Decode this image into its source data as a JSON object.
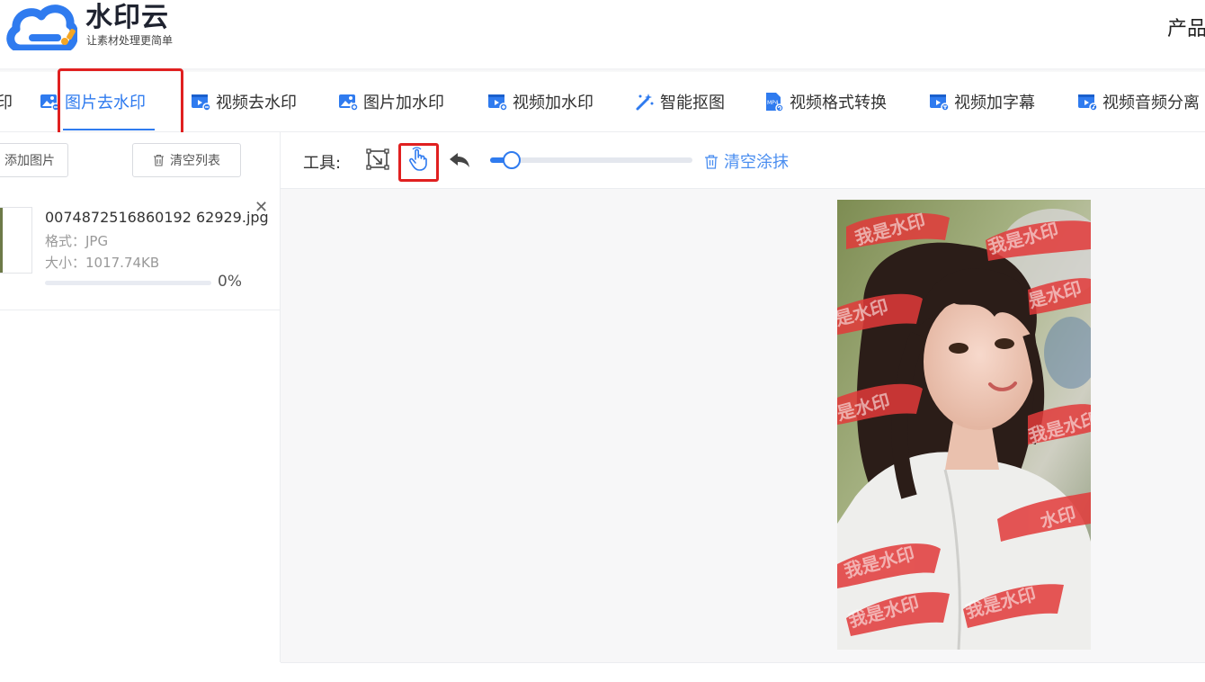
{
  "brand": {
    "name": "水印云",
    "slogan": "让素材处理更简单",
    "accent_color": "#2f7bef"
  },
  "header": {
    "right_menu": "产品"
  },
  "nav": {
    "partial_left": "印",
    "tabs": [
      {
        "label": "图片去水印",
        "icon": "image-remove-icon",
        "active": true
      },
      {
        "label": "视频去水印",
        "icon": "video-remove-icon"
      },
      {
        "label": "图片加水印",
        "icon": "image-add-icon"
      },
      {
        "label": "视频加水印",
        "icon": "video-add-icon"
      },
      {
        "label": "智能抠图",
        "icon": "magic-wand-icon"
      },
      {
        "label": "视频格式转换",
        "icon": "mp4-convert-icon"
      },
      {
        "label": "视频加字幕",
        "icon": "video-subtitle-icon"
      },
      {
        "label": "视频音频分离",
        "icon": "video-audio-split-icon"
      }
    ]
  },
  "file_panel": {
    "add_button": "添加图片",
    "clear_list_button": "清空列表",
    "files": [
      {
        "name": "0074872516860192 62929.jpg",
        "format_line": "格式：JPG",
        "size_line": "大小：1017.74KB",
        "progress": 0,
        "progress_text": "0%"
      }
    ]
  },
  "toolbar": {
    "label": "工具:",
    "tools": [
      "rectangle-select-icon",
      "brush-hand-icon",
      "undo-icon"
    ],
    "brush_size": 0.1,
    "clear_paint": "清空涂抹"
  },
  "canvas": {
    "watermark_text_1": "我是水印",
    "watermark_text_2": "是水印",
    "watermark_text_3": "水印"
  }
}
